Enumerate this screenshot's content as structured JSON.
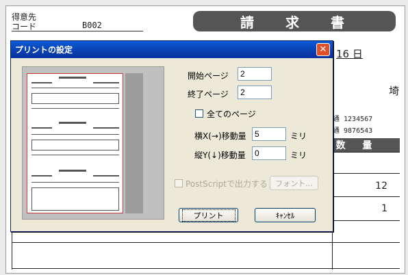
{
  "invoice": {
    "customer_label_line1": "得意先",
    "customer_label_line2": "コード",
    "customer_code": "B002",
    "title": "請求書",
    "date_day": "16 日",
    "address_fragment": "埼",
    "tel_1": "通 1234567",
    "tel_2": "通 9876543",
    "qty_header": "数 量",
    "qty_rows": [
      "12",
      "1"
    ]
  },
  "dialog": {
    "title": "プリントの設定",
    "start_page_label": "開始ページ",
    "start_page_value": "2",
    "end_page_label": "終了ページ",
    "end_page_value": "2",
    "all_pages_label": "全てのページ",
    "offset_x_label": "横X(→)移動量",
    "offset_x_value": "5",
    "offset_y_label": "縦Y(↓)移動量",
    "offset_y_value": "0",
    "unit_label": "ミリ",
    "postscript_label": "PostScriptで出力する",
    "font_button": "フォント...",
    "print_button": "プリント",
    "cancel_button": "ｷｬﾝｾﾙ"
  },
  "colors": {
    "title_bar": "#0a4fc8",
    "dialog_bg": "#ece9d8",
    "close_button": "#e0502a",
    "header_band": "#555555"
  },
  "icons": {
    "close": "close-icon",
    "checkbox": "checkbox-icon"
  }
}
